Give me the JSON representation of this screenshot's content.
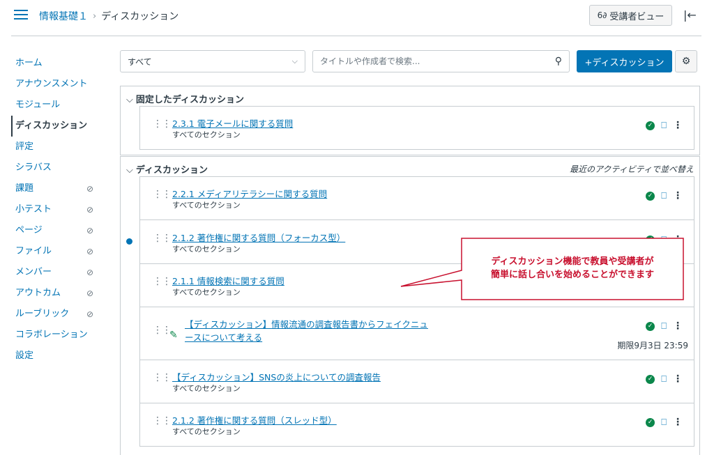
{
  "header": {
    "breadcrumb": {
      "course": "情報基礎１",
      "separator": "›",
      "current": "ディスカッション"
    },
    "student_view_label": "受講者ビュー",
    "student_view_icon": "glasses-icon",
    "collapse_icon": "collapse-left-icon"
  },
  "sidebar": {
    "items": [
      {
        "label": "ホーム",
        "hidden": false
      },
      {
        "label": "アナウンスメント",
        "hidden": false
      },
      {
        "label": "モジュール",
        "hidden": false
      },
      {
        "label": "ディスカッション",
        "hidden": false,
        "active": true
      },
      {
        "label": "評定",
        "hidden": false
      },
      {
        "label": "シラバス",
        "hidden": false
      },
      {
        "label": "課題",
        "hidden": true
      },
      {
        "label": "小テスト",
        "hidden": true
      },
      {
        "label": "ページ",
        "hidden": true
      },
      {
        "label": "ファイル",
        "hidden": true
      },
      {
        "label": "メンバー",
        "hidden": true
      },
      {
        "label": "アウトカム",
        "hidden": true
      },
      {
        "label": "ルーブリック",
        "hidden": true
      },
      {
        "label": "コラボレーション",
        "hidden": false
      },
      {
        "label": "設定",
        "hidden": false
      }
    ]
  },
  "toolbar": {
    "filter_value": "すべて",
    "search_placeholder": "タイトルや作成者で検索...",
    "add_button": "+ディスカッション"
  },
  "pinned": {
    "title": "固定したディスカッション",
    "items": [
      {
        "title": "2.3.1 電子メールに関する質問",
        "subtitle": "すべてのセクション"
      }
    ]
  },
  "discussions": {
    "title": "ディスカッション",
    "sort_label": "最近のアクティビティで並べ替え",
    "items": [
      {
        "title": "2.2.1 メディアリテラシーに関する質問",
        "subtitle": "すべてのセクション"
      },
      {
        "title": "2.1.2 著作権に関する質問（フォーカス型）",
        "subtitle": "すべてのセクション",
        "unread": true
      },
      {
        "title": "2.1.1 情報検索に関する質問",
        "subtitle": "すべてのセクション"
      },
      {
        "title_line1": "【ディスカッション】情報流通の調査報告書からフェイクニュ",
        "title_line2": "ースについて考える",
        "due": "期限9月3日 23:59"
      },
      {
        "title": "【ディスカッション】SNSの炎上についての調査報告",
        "subtitle": "すべてのセクション"
      },
      {
        "title": "2.1.2 著作権に関する質問（スレッド型）",
        "subtitle": "すべてのセクション"
      }
    ]
  },
  "callout": {
    "line1": "ディスカッション機能で教員や受講者が",
    "line2": "簡単に話し合いを始めることができます"
  },
  "colors": {
    "accent": "#0374b5",
    "success": "#0b874b",
    "callout": "#c8102e"
  }
}
